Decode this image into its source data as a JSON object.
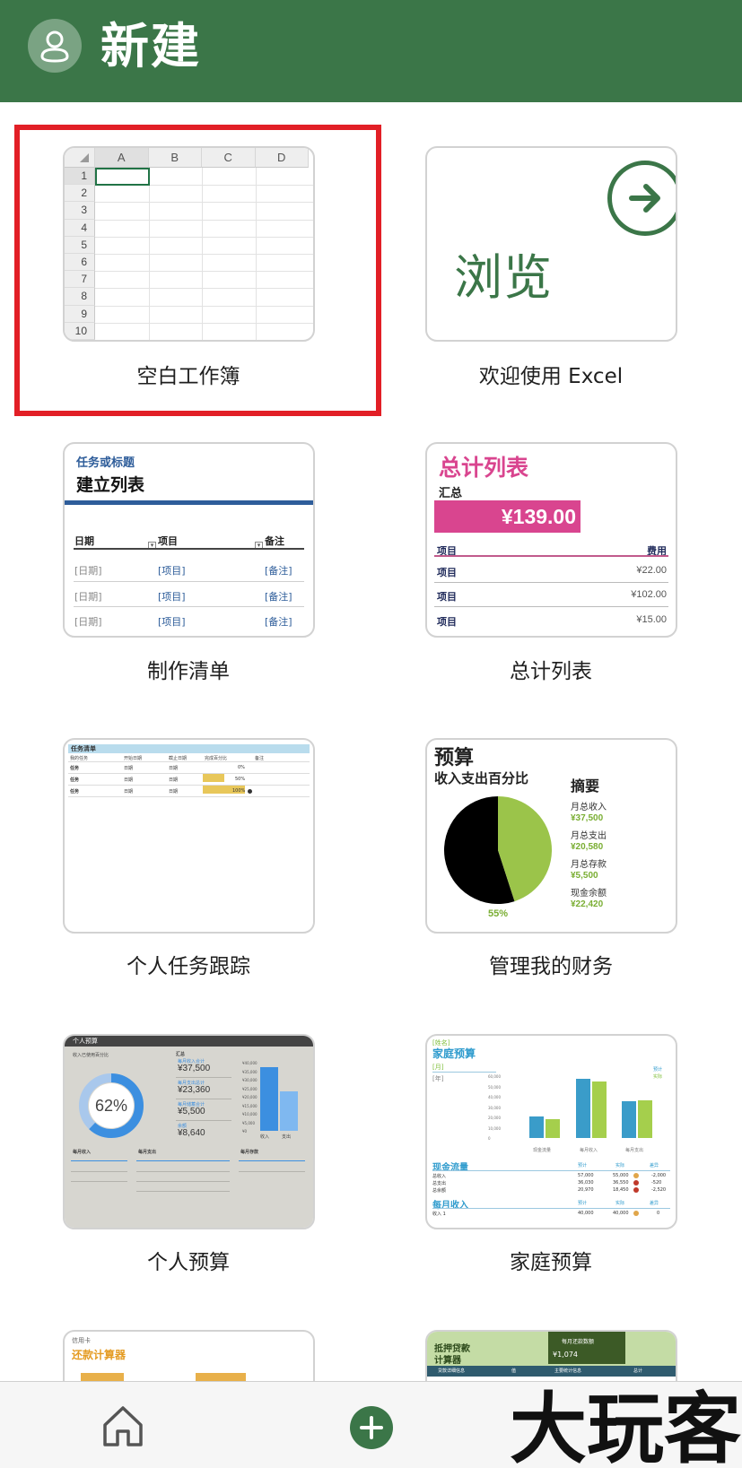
{
  "header": {
    "title": "新建",
    "avatar_icon": "person-icon"
  },
  "colors": {
    "excel_green": "#3b7648",
    "selection_red": "#e21f26",
    "total_pink": "#d9458f",
    "budget_green": "#7aae33",
    "family_blue": "#2e9bcd"
  },
  "templates": [
    {
      "id": "blank",
      "label": "空白工作簿",
      "selected": true
    },
    {
      "id": "browse",
      "label": "欢迎使用 Excel"
    },
    {
      "id": "checklist",
      "label": "制作清单"
    },
    {
      "id": "total",
      "label": "总计列表"
    },
    {
      "id": "tasks",
      "label": "个人任务跟踪"
    },
    {
      "id": "finance",
      "label": "管理我的财务"
    },
    {
      "id": "personal_budget",
      "label": "个人预算"
    },
    {
      "id": "family_budget",
      "label": "家庭预算"
    }
  ],
  "blank": {
    "columns": [
      "A",
      "B",
      "C",
      "D"
    ],
    "rows": [
      "1",
      "2",
      "3",
      "4",
      "5",
      "6",
      "7",
      "8",
      "9",
      "10"
    ]
  },
  "browse": {
    "text": "浏览",
    "icon": "arrow-right-circle-icon"
  },
  "checklist": {
    "subtitle": "任务或标题",
    "title": "建立列表",
    "headers": [
      "日期",
      "项目",
      "备注"
    ],
    "rows": [
      [
        "[日期]",
        "[项目]",
        "[备注]"
      ],
      [
        "[日期]",
        "[项目]",
        "[备注]"
      ],
      [
        "[日期]",
        "[项目]",
        "[备注]"
      ]
    ]
  },
  "total": {
    "title": "总计列表",
    "summary_label": "汇总",
    "summary_value": "¥139.00",
    "headers": [
      "项目",
      "费用"
    ],
    "rows": [
      [
        "项目",
        "¥22.00"
      ],
      [
        "项目",
        "¥102.00"
      ],
      [
        "项目",
        "¥15.00"
      ]
    ]
  },
  "tasks": {
    "header": "任务清单",
    "columns": [
      "我的任务",
      "开始日期",
      "截止日期",
      "完成百分比",
      "备注"
    ],
    "rows": [
      {
        "task": "任务",
        "start": "日期",
        "due": "日期",
        "pct": "0%"
      },
      {
        "task": "任务",
        "start": "日期",
        "due": "日期",
        "pct": "50%"
      },
      {
        "task": "任务",
        "start": "日期",
        "due": "日期",
        "pct": "100%"
      }
    ]
  },
  "finance": {
    "title": "预算",
    "subtitle": "收入支出百分比",
    "summary_title": "摘要",
    "items": [
      {
        "label": "月总收入",
        "value": "¥37,500"
      },
      {
        "label": "月总支出",
        "value": "¥20,580"
      },
      {
        "label": "月总存款",
        "value": "¥5,500"
      },
      {
        "label": "现金余额",
        "value": "¥22,420"
      }
    ],
    "percent_label": "55%",
    "chart_data": {
      "type": "pie",
      "categories": [
        "支出",
        "收入"
      ],
      "values": [
        55,
        45
      ],
      "colors": [
        "#000000",
        "#9bc44a"
      ]
    }
  },
  "personal_budget": {
    "header": "个人预算",
    "left_caption": "收入已使用百分比",
    "summary_label": "汇总",
    "percent": "62%",
    "percent_value": 62,
    "amounts": [
      {
        "caption": "每月收入合计",
        "value": "¥37,500"
      },
      {
        "caption": "每月支出总计",
        "value": "¥23,360"
      },
      {
        "caption": "每月储蓄合计",
        "value": "¥5,500"
      },
      {
        "caption": "余额",
        "value": "¥8,640"
      }
    ],
    "tables": [
      "每月收入",
      "每月支出",
      "每月存款"
    ],
    "chart_data": {
      "type": "bar",
      "categories": [
        "收入",
        "支出"
      ],
      "values": [
        37500,
        23360
      ],
      "ylim": [
        0,
        40000
      ],
      "ticks": [
        "¥40,000",
        "¥35,000",
        "¥30,000",
        "¥25,000",
        "¥20,000",
        "¥15,000",
        "¥10,000",
        "¥5,000",
        "¥0"
      ]
    }
  },
  "family_budget": {
    "name_tag": "[姓名]",
    "title": "家庭预算",
    "month_tag": "[月]",
    "year_tag": "[年]",
    "section1": "现金流量",
    "section2": "每月收入",
    "cashflow_headers": [
      "预计",
      "实际",
      "差异"
    ],
    "cashflow_rows": [
      [
        "总收入",
        "57,000",
        "55,000",
        "-2,000"
      ],
      [
        "总支出",
        "36,030",
        "36,550",
        "-520"
      ],
      [
        "总余额",
        "20,970",
        "18,450",
        "-2,520"
      ]
    ],
    "income_headers": [
      "预计",
      "实际",
      "差异"
    ],
    "income_rows": [
      [
        "收入 1",
        "40,000",
        "40,000",
        "0"
      ]
    ],
    "chart_data": {
      "type": "bar",
      "categories": [
        "现金流量",
        "每月收入",
        "每月支出"
      ],
      "series": [
        {
          "name": "预计",
          "values": [
            20970,
            57000,
            36030
          ]
        },
        {
          "name": "实际",
          "values": [
            18450,
            55000,
            36550
          ]
        }
      ],
      "ylim": [
        0,
        60000
      ],
      "ticks": [
        "60,000",
        "50,000",
        "40,000",
        "30,000",
        "20,000",
        "10,000",
        "0"
      ]
    }
  },
  "credit_card": {
    "subtitle": "信用卡",
    "title": "还款计算器"
  },
  "mortgage": {
    "title1": "抵押贷款",
    "title2": "计算器",
    "box_label": "每月还款数额",
    "box_value": "¥1,074",
    "strip": [
      "贷款详细信息",
      "值",
      "主要统计信息",
      "总计"
    ]
  },
  "bottom_nav": {
    "home_icon": "home-icon",
    "add_icon": "plus-icon"
  },
  "watermark": {
    "text": "大玩客"
  }
}
